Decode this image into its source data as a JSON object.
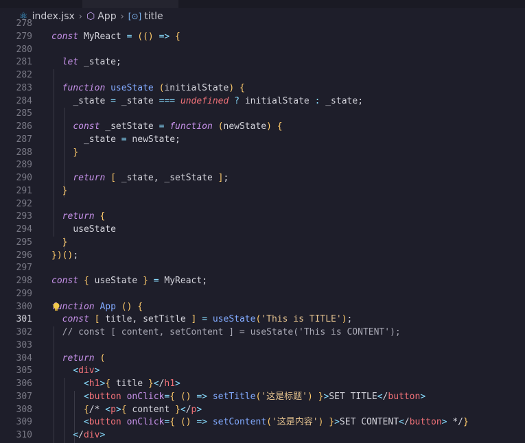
{
  "breadcrumb": {
    "file": "index.jsx",
    "symbol": "App",
    "variable": "title",
    "file_icon": "react-icon",
    "symbol_icon": "cube-icon",
    "variable_icon": "variable-icon"
  },
  "editor": {
    "active_line": 301,
    "lines": [
      {
        "n": "278",
        "t": ""
      },
      {
        "n": "279",
        "t": "const MyReact = (() => {"
      },
      {
        "n": "280",
        "t": ""
      },
      {
        "n": "281",
        "t": "  let _state;"
      },
      {
        "n": "282",
        "t": ""
      },
      {
        "n": "283",
        "t": "  function useState (initialState) {"
      },
      {
        "n": "284",
        "t": "    _state = _state === undefined ? initialState : _state;"
      },
      {
        "n": "285",
        "t": ""
      },
      {
        "n": "286",
        "t": "    const _setState = function (newState) {"
      },
      {
        "n": "287",
        "t": "      _state = newState;"
      },
      {
        "n": "288",
        "t": "    }"
      },
      {
        "n": "289",
        "t": ""
      },
      {
        "n": "290",
        "t": "    return [ _state, _setState ];"
      },
      {
        "n": "291",
        "t": "  }"
      },
      {
        "n": "292",
        "t": ""
      },
      {
        "n": "293",
        "t": "  return {"
      },
      {
        "n": "294",
        "t": "    useState"
      },
      {
        "n": "295",
        "t": "  }"
      },
      {
        "n": "296",
        "t": "})();"
      },
      {
        "n": "297",
        "t": ""
      },
      {
        "n": "298",
        "t": "const { useState } = MyReact;"
      },
      {
        "n": "299",
        "t": ""
      },
      {
        "n": "300",
        "t": "function App () {"
      },
      {
        "n": "301",
        "t": "  const [ title, setTitle ] = useState('This is TITLE');"
      },
      {
        "n": "302",
        "t": "  // const [ content, setContent ] = useState('This is CONTENT');"
      },
      {
        "n": "303",
        "t": ""
      },
      {
        "n": "304",
        "t": "  return ("
      },
      {
        "n": "305",
        "t": "    <div>"
      },
      {
        "n": "306",
        "t": "      <h1>{ title }</h1>"
      },
      {
        "n": "307",
        "t": "      <button onClick={ () => setTitle('这是标题') }>SET TITLE</button>"
      },
      {
        "n": "308",
        "t": "      {/* <p>{ content }</p>"
      },
      {
        "n": "309",
        "t": "      <button onClick={ () => setContent('这是内容') }>SET CONTENT</button> */}"
      },
      {
        "n": "310",
        "t": "    </div>"
      }
    ]
  }
}
